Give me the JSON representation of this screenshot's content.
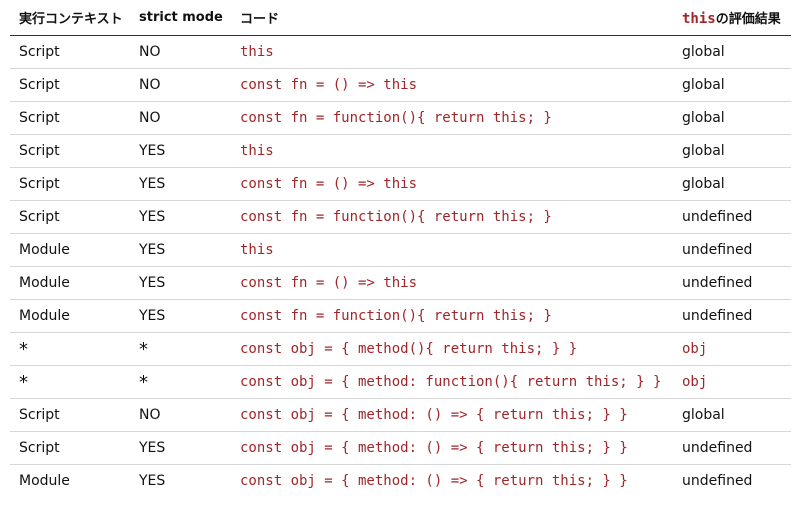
{
  "headers": {
    "context": "実行コンテキスト",
    "strict": "strict mode",
    "code": "コード",
    "result_code": "this",
    "result_suffix": "の評価結果"
  },
  "rows": [
    {
      "context": "Script",
      "strict": "NO",
      "code": "this",
      "result": "global",
      "result_is_code": false
    },
    {
      "context": "Script",
      "strict": "NO",
      "code": "const fn = () => this",
      "result": "global",
      "result_is_code": false
    },
    {
      "context": "Script",
      "strict": "NO",
      "code": "const fn = function(){ return this; }",
      "result": "global",
      "result_is_code": false
    },
    {
      "context": "Script",
      "strict": "YES",
      "code": "this",
      "result": "global",
      "result_is_code": false
    },
    {
      "context": "Script",
      "strict": "YES",
      "code": "const fn = () => this",
      "result": "global",
      "result_is_code": false
    },
    {
      "context": "Script",
      "strict": "YES",
      "code": "const fn = function(){ return this; }",
      "result": "undefined",
      "result_is_code": false
    },
    {
      "context": "Module",
      "strict": "YES",
      "code": "this",
      "result": "undefined",
      "result_is_code": false
    },
    {
      "context": "Module",
      "strict": "YES",
      "code": "const fn = () => this",
      "result": "undefined",
      "result_is_code": false
    },
    {
      "context": "Module",
      "strict": "YES",
      "code": "const fn = function(){ return this; }",
      "result": "undefined",
      "result_is_code": false
    },
    {
      "context": "*",
      "strict": "*",
      "code": "const obj = { method(){ return this; } }",
      "result": "obj",
      "result_is_code": true
    },
    {
      "context": "*",
      "strict": "*",
      "code": "const obj = { method: function(){ return this; } }",
      "result": "obj",
      "result_is_code": true
    },
    {
      "context": "Script",
      "strict": "NO",
      "code": "const obj = { method: () => { return this; } }",
      "result": "global",
      "result_is_code": false
    },
    {
      "context": "Script",
      "strict": "YES",
      "code": "const obj = { method: () => { return this; } }",
      "result": "undefined",
      "result_is_code": false
    },
    {
      "context": "Module",
      "strict": "YES",
      "code": "const obj = { method: () => { return this; } }",
      "result": "undefined",
      "result_is_code": false
    }
  ],
  "colors": {
    "code": "#a0262a",
    "text": "#111111",
    "header_rule": "#333333",
    "row_rule": "#d6d6d6"
  }
}
